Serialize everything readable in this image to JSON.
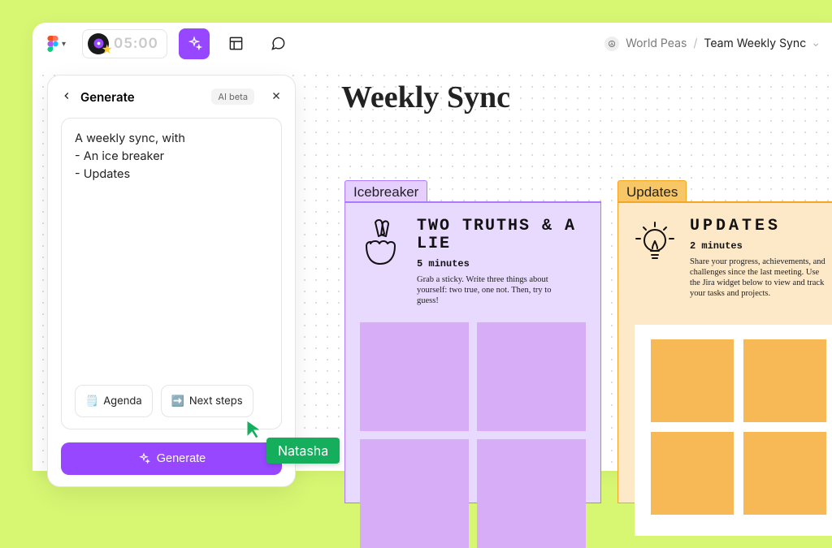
{
  "toolbar": {
    "timer": "05:00"
  },
  "breadcrumb": {
    "workspace": "World Peas",
    "page": "Team Weekly Sync"
  },
  "generate": {
    "title": "Generate",
    "beta_label": "AI beta",
    "prompt_line1": "A weekly sync, with",
    "prompt_line2": "- An ice breaker",
    "prompt_line3": "- Updates",
    "chip_agenda": "Agenda",
    "chip_next": "Next steps",
    "button": "Generate"
  },
  "canvas": {
    "title": "Weekly Sync",
    "ice": {
      "tag": "Icebreaker",
      "heading": "TWO TRUTHS & A LIE",
      "subheading": "5 minutes",
      "desc": "Grab a sticky. Write three things about yourself: two true, one not. Then, try to guess!"
    },
    "upd": {
      "tag": "Updates",
      "heading": "UPDATES",
      "subheading": "2 minutes",
      "desc": "Share your progress, achievements, and challenges since the last meeting. Use the Jira widget below to view and track your tasks and projects."
    }
  },
  "presence": {
    "name": "Natasha"
  }
}
